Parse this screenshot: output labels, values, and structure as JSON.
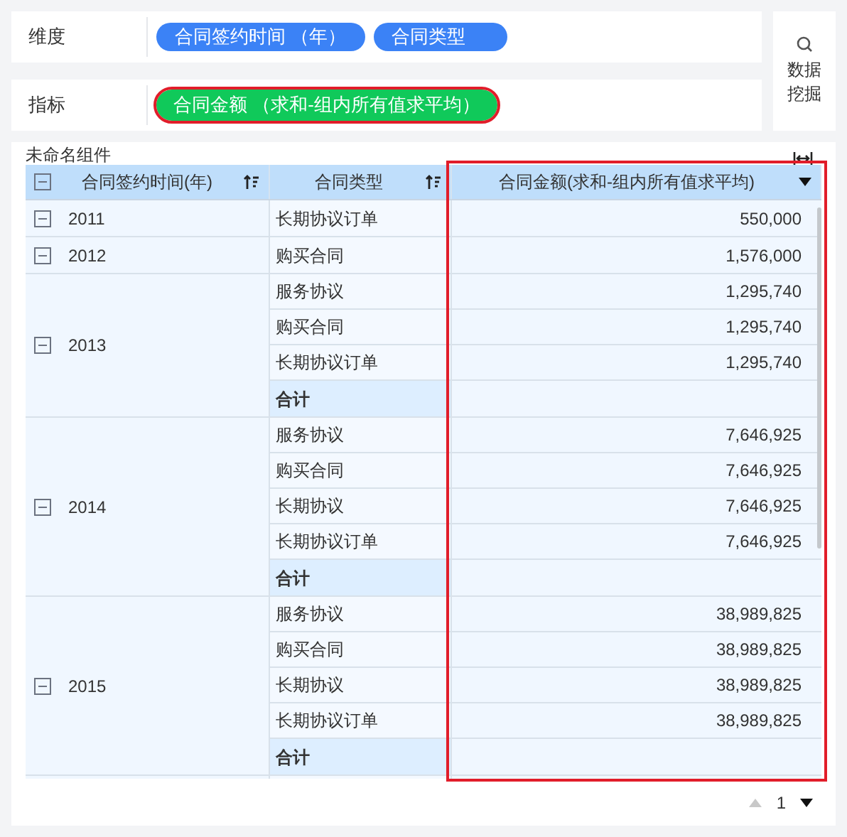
{
  "dimension": {
    "label": "维度",
    "chips": [
      "合同签约时间 （年）",
      "合同类型"
    ]
  },
  "metric": {
    "label": "指标",
    "chips": [
      {
        "text": "合同金额 （求和-组内所有值求平均）",
        "highlighted": true
      }
    ]
  },
  "mining_button": {
    "label": "数据挖掘"
  },
  "component": {
    "title": "未命名组件"
  },
  "table": {
    "columns": [
      {
        "label": "合同签约时间(年)",
        "sortable": true
      },
      {
        "label": "合同类型",
        "sortable": true
      },
      {
        "label": "合同金额(求和-组内所有值求平均)",
        "sortable": false,
        "highlighted": true
      }
    ],
    "groups": [
      {
        "year": "2011",
        "expanded": true,
        "rows": [
          {
            "kind": "data",
            "type": "长期协议订单",
            "value": "550,000"
          }
        ]
      },
      {
        "year": "2012",
        "expanded": true,
        "rows": [
          {
            "kind": "data",
            "type": "购买合同",
            "value": "1,576,000"
          }
        ]
      },
      {
        "year": "2013",
        "expanded": true,
        "rows": [
          {
            "kind": "data",
            "type": "服务协议",
            "value": "1,295,740"
          },
          {
            "kind": "data",
            "type": "购买合同",
            "value": "1,295,740"
          },
          {
            "kind": "data",
            "type": "长期协议订单",
            "value": "1,295,740"
          },
          {
            "kind": "total",
            "type": "合计"
          }
        ]
      },
      {
        "year": "2014",
        "expanded": true,
        "rows": [
          {
            "kind": "data",
            "type": "服务协议",
            "value": "7,646,925"
          },
          {
            "kind": "data",
            "type": "购买合同",
            "value": "7,646,925"
          },
          {
            "kind": "data",
            "type": "长期协议",
            "value": "7,646,925"
          },
          {
            "kind": "data",
            "type": "长期协议订单",
            "value": "7,646,925"
          },
          {
            "kind": "total",
            "type": "合计"
          }
        ]
      },
      {
        "year": "2015",
        "expanded": true,
        "rows": [
          {
            "kind": "data",
            "type": "服务协议",
            "value": "38,989,825"
          },
          {
            "kind": "data",
            "type": "购买合同",
            "value": "38,989,825"
          },
          {
            "kind": "data",
            "type": "长期协议",
            "value": "38,989,825"
          },
          {
            "kind": "data",
            "type": "长期协议订单",
            "value": "38,989,825"
          },
          {
            "kind": "total",
            "type": "合计"
          }
        ]
      }
    ]
  },
  "pager": {
    "page": "1"
  }
}
